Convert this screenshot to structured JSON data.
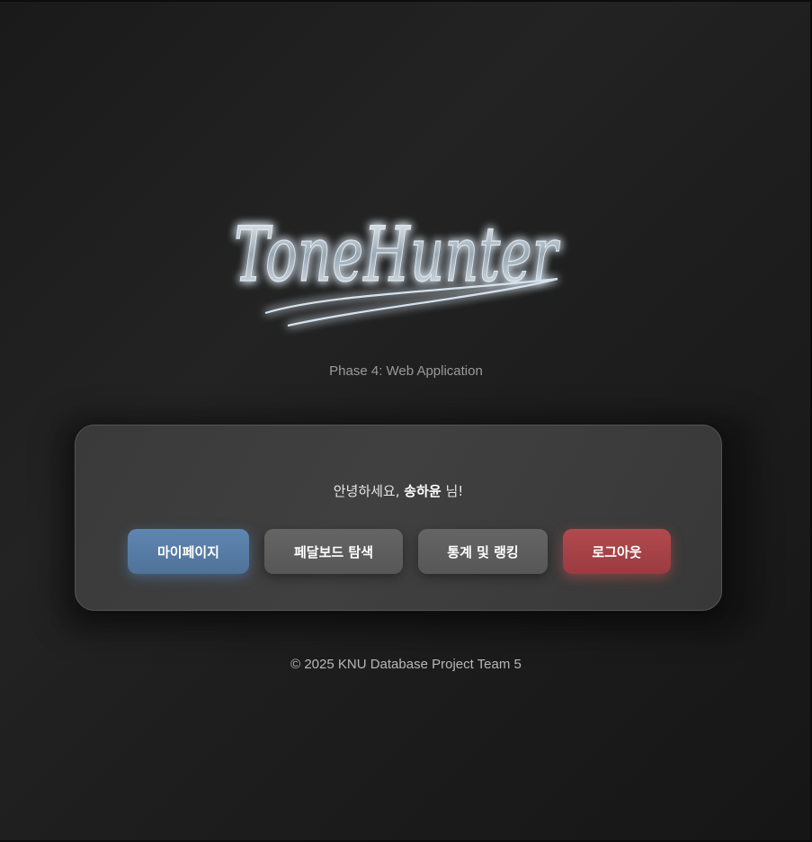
{
  "header": {
    "logo_text": "ToneHunter",
    "subtitle": "Phase 4: Web Application"
  },
  "card": {
    "greeting_prefix": "안녕하세요, ",
    "user_name": "송하윤",
    "greeting_suffix": " 님!",
    "buttons": {
      "mypage": "마이페이지",
      "pedalboard_search": "페달보드 탐색",
      "stats_ranking": "통계 및 랭킹",
      "logout": "로그아웃"
    }
  },
  "footer": {
    "copyright": "© 2025 KNU Database Project Team 5"
  },
  "colors": {
    "background": "#1e1e1e",
    "card": "#3c3c3c",
    "mypage_button": "#5a7fab",
    "neutral_button": "#5f5f5f",
    "logout_button": "#a84448",
    "logo_glow": "#bcd8f0"
  }
}
